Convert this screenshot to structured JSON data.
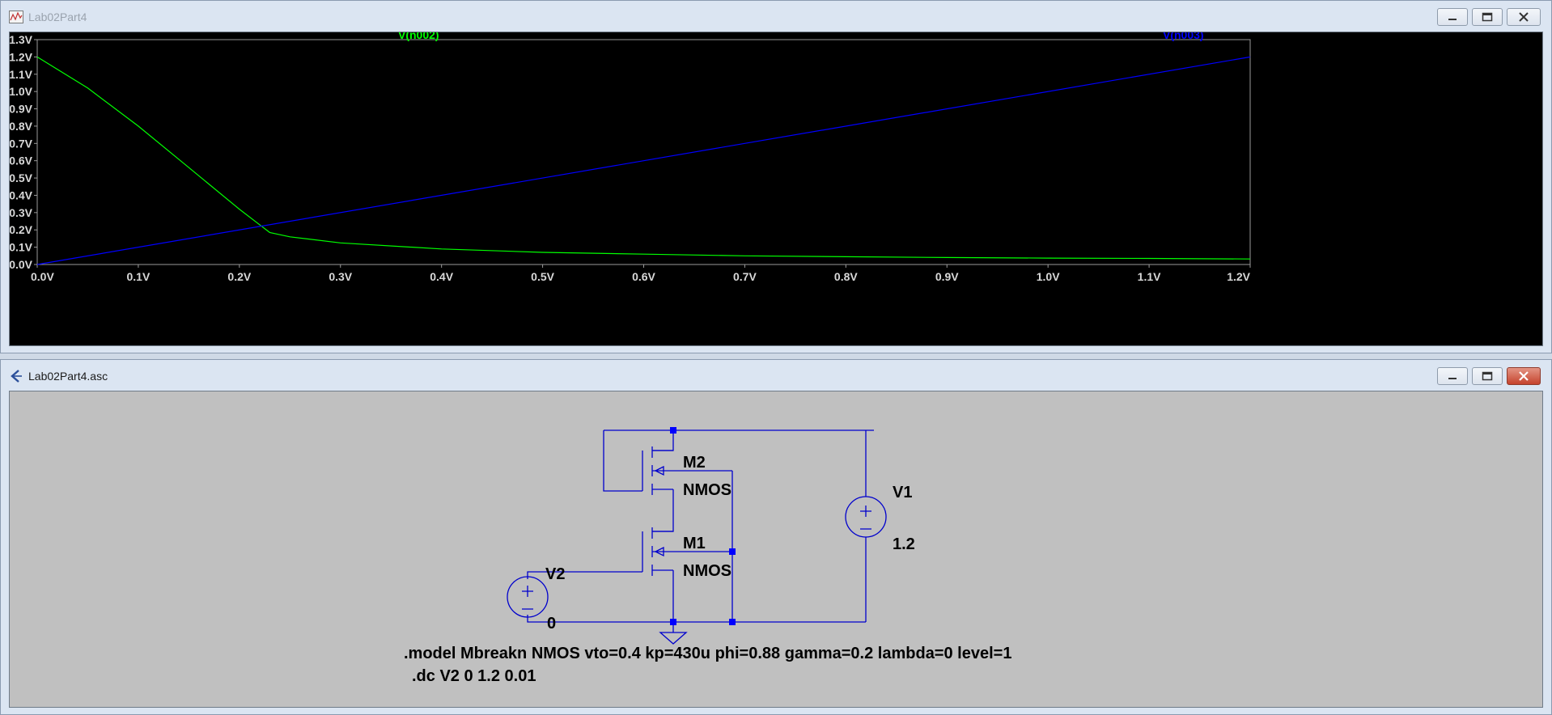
{
  "plot_window": {
    "title": "Lab02Part4",
    "controls": {
      "minimize": "minimize",
      "maximize": "maximize",
      "close": "close"
    }
  },
  "schematic_window": {
    "title": "Lab02Part4.asc",
    "controls": {
      "minimize": "minimize",
      "maximize": "maximize",
      "close": "close"
    }
  },
  "chart_data": {
    "type": "line",
    "title": "",
    "xlabel": "",
    "ylabel": "",
    "xlim": [
      0.0,
      1.2
    ],
    "ylim": [
      0.0,
      1.3
    ],
    "x_ticks": [
      "0.0V",
      "0.1V",
      "0.2V",
      "0.3V",
      "0.4V",
      "0.5V",
      "0.6V",
      "0.7V",
      "0.8V",
      "0.9V",
      "1.0V",
      "1.1V",
      "1.2V"
    ],
    "y_ticks": [
      "0.0V",
      "0.1V",
      "0.2V",
      "0.3V",
      "0.4V",
      "0.5V",
      "0.6V",
      "0.7V",
      "0.8V",
      "0.9V",
      "1.0V",
      "1.1V",
      "1.2V",
      "1.3V"
    ],
    "grid": false,
    "legend": "top",
    "series": [
      {
        "name": "V(n002)",
        "color": "#00ff00",
        "x": [
          0.0,
          0.05,
          0.1,
          0.15,
          0.2,
          0.22,
          0.23,
          0.25,
          0.3,
          0.4,
          0.5,
          0.6,
          0.7,
          0.8,
          0.9,
          1.0,
          1.1,
          1.2
        ],
        "y": [
          1.2,
          1.02,
          0.8,
          0.56,
          0.32,
          0.23,
          0.185,
          0.16,
          0.125,
          0.09,
          0.07,
          0.06,
          0.05,
          0.045,
          0.04,
          0.037,
          0.035,
          0.032
        ]
      },
      {
        "name": "V(n003)",
        "color": "#0000ff",
        "x": [
          0.0,
          1.2
        ],
        "y": [
          0.0,
          1.2
        ]
      }
    ]
  },
  "schematic": {
    "components": {
      "m2_name": "M2",
      "m2_model": "NMOS",
      "m1_name": "M1",
      "m1_model": "NMOS",
      "v1_name": "V1",
      "v1_value": "1.2",
      "v2_name": "V2",
      "v2_value": "0"
    },
    "directives": {
      "model": ".model  Mbreakn NMOS vto=0.4 kp=430u phi=0.88 gamma=0.2 lambda=0 level=1",
      "dc": ".dc V2 0 1.2 0.01"
    }
  }
}
